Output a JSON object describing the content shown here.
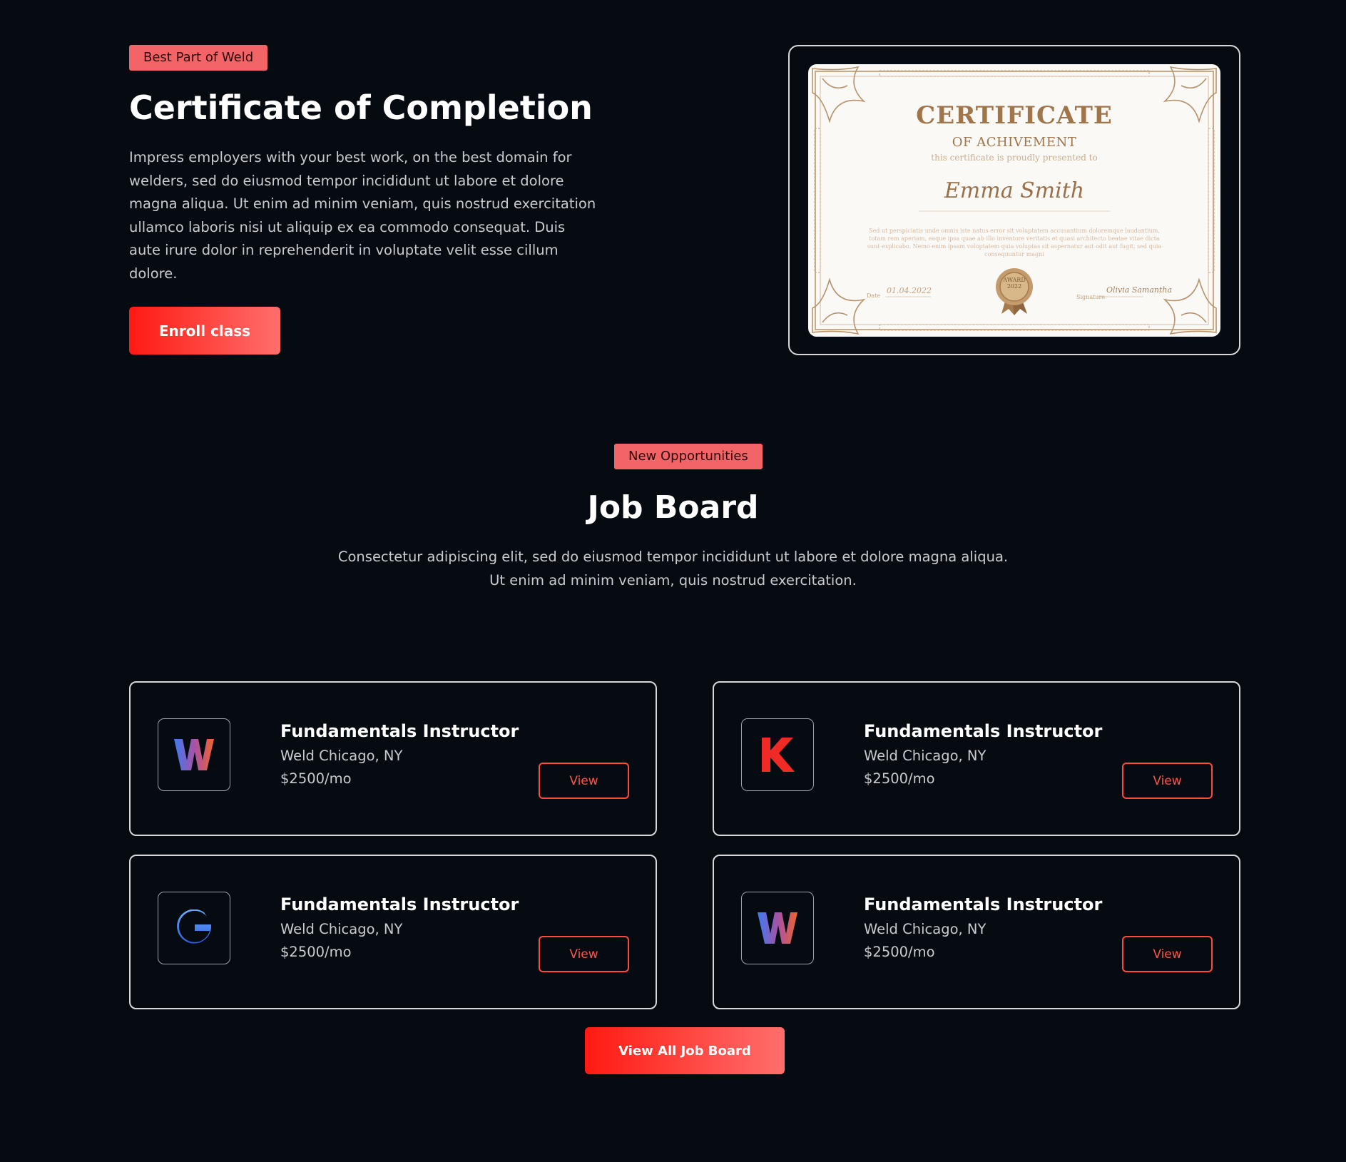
{
  "certificate_section": {
    "badge": "Best Part of Weld",
    "title": "Certificate of Completion",
    "description": "Impress employers with your best work, on the best domain for welders, sed do eiusmod tempor incididunt ut labore et dolore magna aliqua. Ut enim ad minim veniam, quis nostrud exercitation ullamco laboris nisi ut aliquip ex ea commodo consequat. Duis aute irure dolor in reprehenderit in voluptate velit esse cillum dolore.",
    "enroll_label": "Enroll class",
    "certificate_image": {
      "heading": "CERTIFICATE",
      "subheading": "OF ACHIVEMENT",
      "presented": "this certificate is proudly presented to",
      "name": "Emma Smith",
      "body": "Sed ut perspiciatis unde omnis iste natus error sit voluptatem accusantium doloremque laudantium, totam rem aperiam, eaque ipsa quae ab illo inventore veritatis et quasi architecto beatae vitae dicta sunt explicabo. Nemo enim ipsam voluptatem quia voluptas sit aspernatur aut odit aut fugit, sed quia consequuntur magni",
      "date": "01.04.2022",
      "date_label": "Date",
      "signature": "Olivia Samantha",
      "signature_label": "Signature",
      "seal": "AWARD 2022"
    }
  },
  "job_board": {
    "badge": "New Opportunities",
    "title": "Job Board",
    "description_line1": "Consectetur adipiscing elit, sed do eiusmod tempor incididunt ut labore et dolore magna aliqua.",
    "description_line2": "Ut enim ad minim veniam, quis nostrud exercitation.",
    "jobs": [
      {
        "logo": "W",
        "logo_icon": "w-logo-icon",
        "title": "Fundamentals Instructor",
        "location": "Weld Chicago, NY",
        "pay": "$2500/mo",
        "view_label": "View"
      },
      {
        "logo": "K",
        "logo_icon": "k-logo-icon",
        "title": "Fundamentals Instructor",
        "location": "Weld Chicago, NY",
        "pay": "$2500/mo",
        "view_label": "View"
      },
      {
        "logo": "G",
        "logo_icon": "g-logo-icon",
        "title": "Fundamentals Instructor",
        "location": "Weld Chicago, NY",
        "pay": "$2500/mo",
        "view_label": "View"
      },
      {
        "logo": "W",
        "logo_icon": "w-logo-icon",
        "title": "Fundamentals Instructor",
        "location": "Weld Chicago, NY",
        "pay": "$2500/mo",
        "view_label": "View"
      }
    ],
    "view_all_label": "View All Job Board"
  },
  "colors": {
    "background": "#060b12",
    "accent": "#ff1a12",
    "badge": "#f36466",
    "certificate_gold": "#9f7549"
  }
}
